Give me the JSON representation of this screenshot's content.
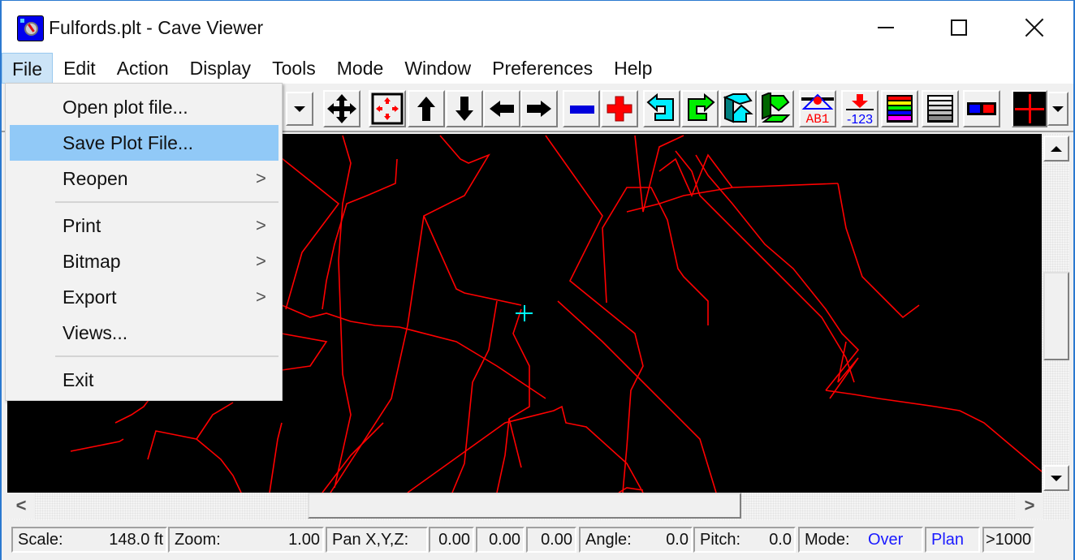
{
  "window": {
    "title": "Fulfords.plt - Cave Viewer",
    "app_icon": "cave-viewer-compass-icon",
    "controls": {
      "minimize": "minimize-icon",
      "maximize": "maximize-icon",
      "close": "close-icon"
    }
  },
  "menubar": {
    "items": [
      {
        "label": "File",
        "active": true
      },
      {
        "label": "Edit"
      },
      {
        "label": "Action"
      },
      {
        "label": "Display"
      },
      {
        "label": "Tools"
      },
      {
        "label": "Mode"
      },
      {
        "label": "Window"
      },
      {
        "label": "Preferences"
      },
      {
        "label": "Help"
      }
    ]
  },
  "file_menu": {
    "items": [
      {
        "label": "Open plot file...",
        "submenu": false
      },
      {
        "label": "Save Plot File...",
        "submenu": false,
        "highlighted": true
      },
      {
        "label": "Reopen",
        "submenu": true
      },
      {
        "separator": true
      },
      {
        "label": "Print",
        "submenu": true
      },
      {
        "label": "Bitmap",
        "submenu": true
      },
      {
        "label": "Export",
        "submenu": true
      },
      {
        "label": "Views...",
        "submenu": false
      },
      {
        "separator": true
      },
      {
        "label": "Exit",
        "submenu": false
      }
    ],
    "submenu_arrow": ">"
  },
  "toolbar": {
    "buttons": [
      {
        "name": "view-dropdown",
        "icon": "chevron-down-icon"
      },
      {
        "name": "pan",
        "icon": "move-arrows-icon"
      },
      {
        "name": "center-fit",
        "icon": "fit-to-window-icon"
      },
      {
        "name": "pan-up",
        "icon": "arrow-up-icon"
      },
      {
        "name": "pan-down",
        "icon": "arrow-down-icon"
      },
      {
        "name": "pan-left",
        "icon": "arrow-left-icon"
      },
      {
        "name": "pan-right",
        "icon": "arrow-right-icon"
      },
      {
        "name": "zoom-out",
        "icon": "minus-icon"
      },
      {
        "name": "zoom-in",
        "icon": "plus-icon"
      },
      {
        "name": "rotate-left",
        "icon": "rotate-left-icon"
      },
      {
        "name": "rotate-right",
        "icon": "rotate-right-icon"
      },
      {
        "name": "tilt-up",
        "icon": "tilt-up-icon"
      },
      {
        "name": "tilt-down",
        "icon": "tilt-down-icon"
      },
      {
        "name": "station-labels",
        "icon": "station-labels-icon",
        "text": "AB1"
      },
      {
        "name": "depth-values",
        "icon": "depth-values-icon",
        "text": "-123"
      },
      {
        "name": "color-by-depth",
        "icon": "color-bars-icon"
      },
      {
        "name": "grayscale",
        "icon": "grayscale-bars-icon"
      },
      {
        "name": "stereo-3d",
        "icon": "3d-glasses-icon"
      },
      {
        "name": "cursor-style",
        "icon": "crosshair-icon"
      },
      {
        "name": "cursor-dropdown",
        "icon": "chevron-down-icon"
      }
    ]
  },
  "colors": {
    "survey_lines": "#ff0000",
    "cursor": "#00ffff",
    "canvas_bg": "#000000",
    "mode_value": "#1a1aff",
    "menu_highlight": "#91c9f7"
  },
  "statusbar": {
    "scale_label": "Scale:",
    "scale_value": "148.0 ft",
    "zoom_label": "Zoom:",
    "zoom_value": "1.00",
    "pan_label": "Pan X,Y,Z:",
    "pan_x": "0.00",
    "pan_y": "0.00",
    "pan_z": "0.00",
    "angle_label": "Angle:",
    "angle_value": "0.0",
    "pitch_label": "Pitch:",
    "pitch_value": "0.0",
    "mode_label": "Mode:",
    "mode_value": "Over",
    "view_value": "Plan",
    "count_value": ">1000"
  },
  "scrollbars": {
    "vertical": {
      "up": "scroll-up-icon",
      "down": "scroll-down-icon"
    },
    "horizontal": {
      "left": "<",
      "right": ">"
    }
  }
}
